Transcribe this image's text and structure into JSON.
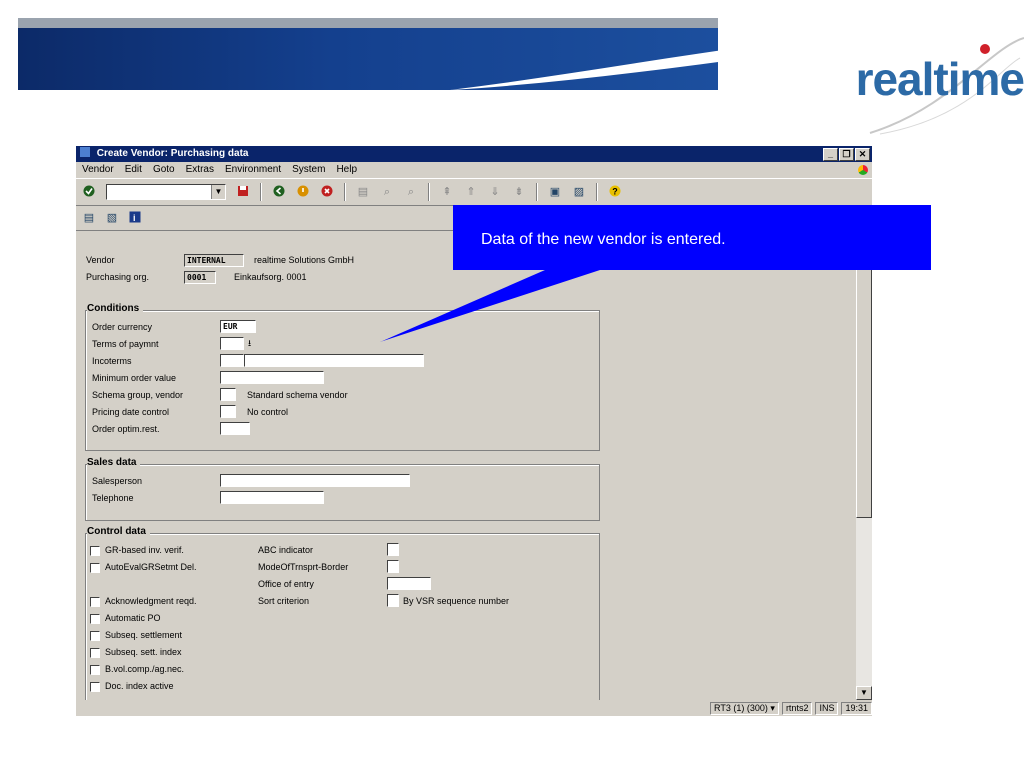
{
  "brand": {
    "logo_text": "realtime"
  },
  "window": {
    "title": "Create Vendor: Purchasing data",
    "controls": [
      "_",
      "❐",
      "✕"
    ]
  },
  "menu": [
    "Vendor",
    "Edit",
    "Goto",
    "Extras",
    "Environment",
    "System",
    "Help"
  ],
  "toolbar": {
    "command_field_value": "",
    "icons": [
      "check-icon",
      "save-icon",
      "back-icon",
      "exit-icon",
      "cancel-icon",
      "print-icon",
      "find-icon",
      "find-next-icon",
      "first-page-icon",
      "prev-page-icon",
      "next-page-icon",
      "last-page-icon",
      "new-session-icon",
      "shortcut-icon",
      "help-icon"
    ]
  },
  "app_toolbar": {
    "icons": [
      "address-icon",
      "alt-data-icon",
      "info-icon"
    ]
  },
  "header": {
    "vendor_label": "Vendor",
    "vendor_value": "INTERNAL",
    "vendor_name": "realtime Solutions GmbH",
    "porg_label": "Purchasing org.",
    "porg_value": "0001",
    "porg_name": "Einkaufsorg. 0001"
  },
  "conditions": {
    "title": "Conditions",
    "order_currency_label": "Order currency",
    "order_currency_value": "EUR",
    "terms_label": "Terms of paymnt",
    "incoterms_label": "Incoterms",
    "min_order_label": "Minimum order value",
    "schema_group_label": "Schema group, vendor",
    "schema_group_text": "Standard schema vendor",
    "pricing_date_label": "Pricing date control",
    "pricing_date_text": "No control",
    "order_optim_label": "Order optim.rest."
  },
  "sales": {
    "title": "Sales data",
    "salesperson_label": "Salesperson",
    "telephone_label": "Telephone"
  },
  "control": {
    "title": "Control data",
    "checkboxes": [
      "GR-based inv. verif.",
      "AutoEvalGRSetmt Del.",
      "Acknowledgment reqd.",
      "Automatic PO",
      "Subseq. settlement",
      "Subseq. sett. index",
      "B.vol.comp./ag.nec.",
      "Doc. index active"
    ],
    "abc_label": "ABC indicator",
    "mode_label": "ModeOfTrnsprt-Border",
    "office_label": "Office of entry",
    "sort_label": "Sort criterion",
    "sort_text": "By VSR sequence number"
  },
  "status": {
    "system": "RT3 (1) (300)",
    "server": "rtnts2",
    "mode": "INS",
    "time": "19:31"
  },
  "callout": {
    "text": "Data of the new vendor is entered."
  },
  "colors": {
    "title_bar": "#0a246a",
    "callout": "#0000ff",
    "banner": "#14408e"
  }
}
